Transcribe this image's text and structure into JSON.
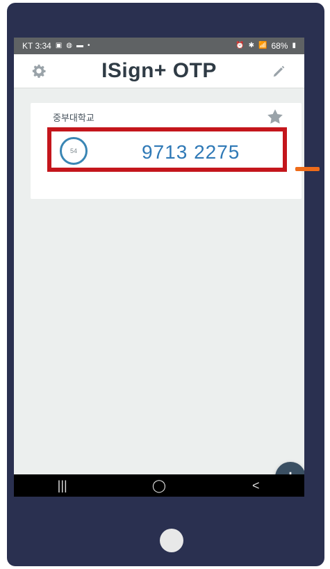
{
  "status_bar": {
    "carrier_time": "KT 3:34",
    "left_icons": [
      "image-icon",
      "chat-icon",
      "message-icon",
      "dot-icon"
    ],
    "battery": "68%",
    "right_icons": [
      "alarm-icon",
      "bluetooth-icon",
      "wifi-icon",
      "signal-icon",
      "battery-icon"
    ]
  },
  "app_bar": {
    "title": "ISign+ OTP",
    "left_icon": "settings-gear-icon",
    "right_icon": "edit-pencil-icon"
  },
  "otp_card": {
    "organization": "중부대학교",
    "timer_seconds": "54",
    "code": "9713 2275",
    "favorite_icon": "star-icon"
  },
  "fab": {
    "label": "+"
  },
  "nav_bar": {
    "recent_label": "|||",
    "home_label": "◯",
    "back_label": "<"
  },
  "colors": {
    "frame": "#2a3050",
    "highlight": "#c4161c",
    "accent": "#2f79b6",
    "connector": "#ee6c1a"
  }
}
